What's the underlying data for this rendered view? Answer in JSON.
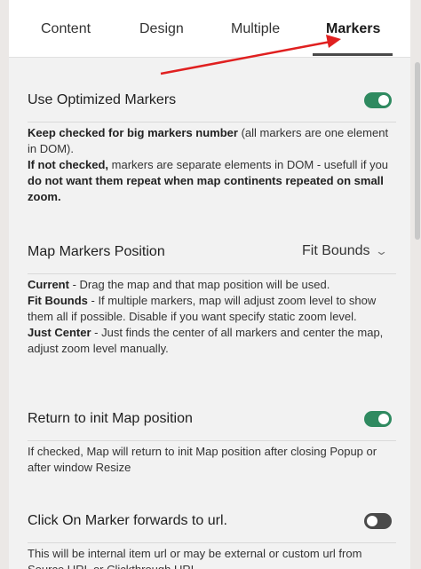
{
  "tabs": [
    {
      "label": "Content",
      "active": false
    },
    {
      "label": "Design",
      "active": false
    },
    {
      "label": "Multiple",
      "active": false
    },
    {
      "label": "Markers",
      "active": true
    }
  ],
  "settings": {
    "optimized": {
      "title": "Use Optimized Markers",
      "enabled": true,
      "desc_b1": "Keep checked for big markers number",
      "desc_t1": " (all markers are one element in DOM).",
      "desc_b2": "If not checked,",
      "desc_t2": " markers are separate elements in DOM - usefull if you ",
      "desc_b3": "do not want them repeat when map continents repeated on small zoom."
    },
    "position": {
      "title": "Map Markers Position",
      "selected": "Fit Bounds",
      "b1": "Current",
      "t1": " - Drag the map and that map position will be used.",
      "b2": "Fit Bounds",
      "t2": " - If multiple markers, map will adjust zoom level to show them all if possible. Disable if you want specify static zoom level.",
      "b3": "Just Center",
      "t3": " - Just finds the center of all markers and center the map, adjust zoom level manually."
    },
    "return_init": {
      "title": "Return to init Map position",
      "enabled": true,
      "desc": "If checked, Map will return to init Map position after closing Popup or after window Resize"
    },
    "click_marker": {
      "title": "Click On Marker forwards to url.",
      "enabled": false,
      "desc": "This will be internal item url or may be external or custom url from Source URL or Clickthrough URL"
    }
  },
  "colors": {
    "toggle_on": "#2f8a60",
    "toggle_off": "#4a4a4a",
    "annotation_arrow": "#e02020"
  }
}
